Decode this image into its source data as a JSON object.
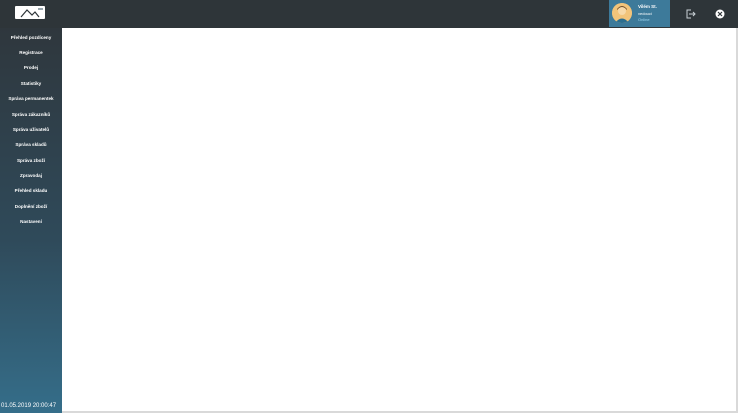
{
  "header": {
    "user": {
      "name": "Vilém St.",
      "role": "vedoucí",
      "status": "Online"
    }
  },
  "sidebar": {
    "items": [
      {
        "label": "Přehled pozdíceny",
        "icon": "nav-item"
      },
      {
        "label": "Registrace"
      },
      {
        "label": "Prodej"
      },
      {
        "label": "Statistiky"
      },
      {
        "label": "Správa permanentek"
      },
      {
        "label": "Správa zákazníků"
      },
      {
        "label": "Správa uživatelů"
      },
      {
        "label": "Správa skladů"
      },
      {
        "label": "Správa zboží"
      },
      {
        "label": "Zpravodaj"
      },
      {
        "label": "Přehled skladu"
      },
      {
        "label": "Doplnění zboží"
      },
      {
        "label": "Nastavení"
      }
    ]
  },
  "footer": {
    "datetime": "01.05.2019 20:00:47"
  },
  "colors": {
    "topbar": "#2e3539",
    "accent": "#3d7a9a",
    "sidebar_top": "#2f373d",
    "sidebar_bottom": "#356e8a"
  }
}
